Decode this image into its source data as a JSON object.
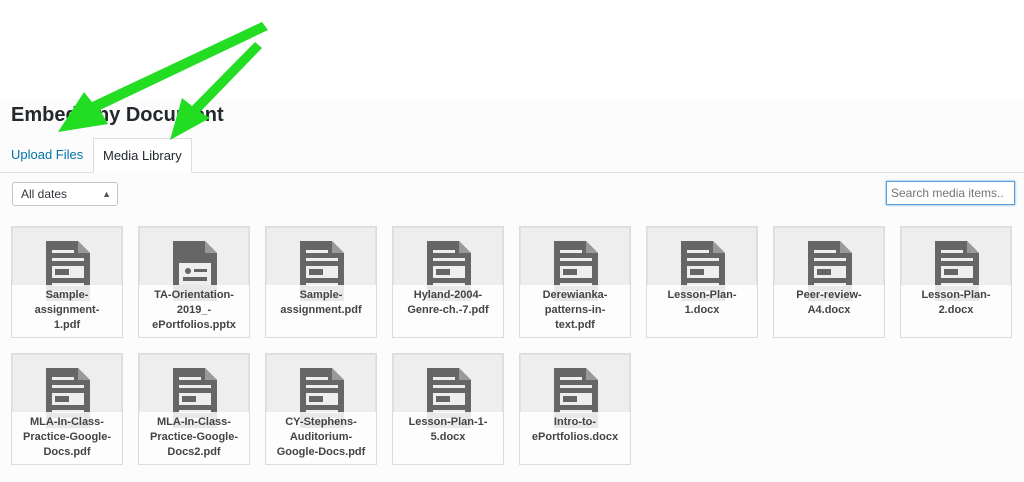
{
  "modal": {
    "title": "Embed Any Document",
    "tabs": [
      {
        "label": "Upload Files"
      },
      {
        "label": "Media Library"
      }
    ]
  },
  "filter": {
    "date_select": "All dates"
  },
  "search": {
    "placeholder": "Search media items.."
  },
  "media_items": [
    {
      "name": "Sample-\nassignment-\n1.pdf",
      "icon": "document-icon"
    },
    {
      "name": "TA-Orientation-\n2019_-\nePortfolios.pptx",
      "icon": "presentation-icon"
    },
    {
      "name": "Sample-\nassignment.pdf",
      "icon": "document-icon"
    },
    {
      "name": "Hyland-2004-\nGenre-ch.-7.pdf",
      "icon": "document-icon"
    },
    {
      "name": "Derewianka-\npatterns-in-\ntext.pdf",
      "icon": "document-icon"
    },
    {
      "name": "Lesson-Plan-\n1.docx",
      "icon": "document-icon"
    },
    {
      "name": "Peer-review-\nA4.docx",
      "icon": "document-icon"
    },
    {
      "name": "Lesson-Plan-\n2.docx",
      "icon": "document-icon"
    },
    {
      "name": "MLA-In-Class-\nPractice-Google-\nDocs.pdf",
      "icon": "document-icon"
    },
    {
      "name": "MLA-In-Class-\nPractice-Google-\nDocs2.pdf",
      "icon": "document-icon"
    },
    {
      "name": "CY-Stephens-\nAuditorium-\nGoogle-Docs.pdf",
      "icon": "document-icon"
    },
    {
      "name": "Lesson-Plan-1-\n5.docx",
      "icon": "document-icon"
    },
    {
      "name": "Intro-to-\nePortfolios.docx",
      "icon": "document-icon"
    }
  ],
  "colors": {
    "link": "#0073aa",
    "arrow_annotation": "#22dd22",
    "tile_bg": "#eeeeee"
  }
}
